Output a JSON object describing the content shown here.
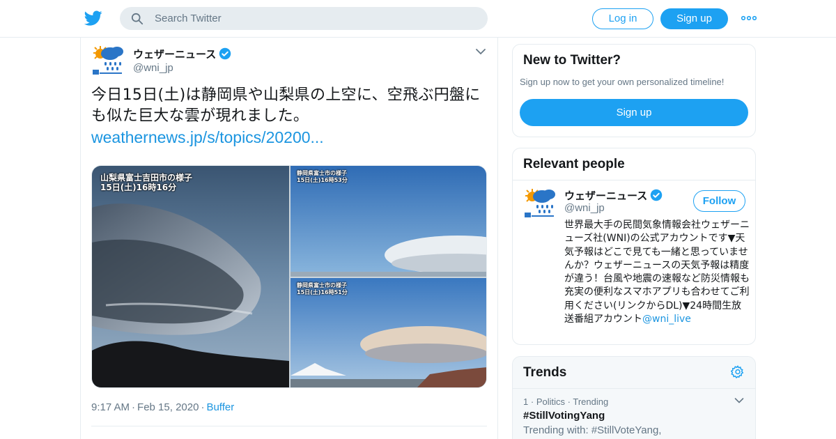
{
  "header": {
    "logo_icon": "twitter-bird-icon",
    "search_placeholder": "Search Twitter",
    "login_label": "Log in",
    "signup_label": "Sign up",
    "more_icon": "more-dots-icon"
  },
  "tweet": {
    "author_name": "ウェザーニュース",
    "author_handle": "@wni_jp",
    "verified": true,
    "text": "今日15日(土)は静岡県や山梨県の上空に、空飛ぶ円盤にも似た巨大な雲が現れました。",
    "link": "weathernews.jp/s/topics/20200...",
    "media": [
      {
        "caption_line1": "山梨県富士吉田市の様子",
        "caption_line2": "15日(土)16時16分"
      },
      {
        "caption_line1": "静岡県富士市の様子",
        "caption_line2": "15日(土)16時53分"
      },
      {
        "caption_line1": "静岡県富士市の様子",
        "caption_line2": "15日(土)16時51分"
      }
    ],
    "time": "9:17 AM",
    "separator": "·",
    "date": "Feb 15, 2020",
    "source": "Buffer"
  },
  "sidebar": {
    "new_to_twitter": {
      "title": "New to Twitter?",
      "subtitle": "Sign up now to get your own personalized timeline!",
      "button": "Sign up"
    },
    "relevant_people": {
      "title": "Relevant people",
      "name": "ウェザーニュース",
      "handle": "@wni_jp",
      "follow_label": "Follow",
      "bio": "世界最大手の民間気象情報会社ウェザーニューズ社(WNI)の公式アカウントです▼天気予報はどこで見ても一緒と思っていませんか？ウェザーニュースの天気予報は精度が違う！台風や地震の速報など防災情報も充実の便利なスマホアプリも合わせてご利用ください(リンクからDL)▼24時間生放送番組アカウント",
      "bio_mention": "@wni_live"
    },
    "trends": {
      "title": "Trends",
      "items": [
        {
          "rank": "1",
          "category": "Politics",
          "status": "Trending",
          "sep": "·",
          "name": "#StillVotingYang",
          "with": "Trending with: #StillVoteYang,"
        }
      ]
    }
  },
  "colors": {
    "accent": "#1da1f2",
    "link": "#1b95e0",
    "text": "#14171a",
    "secondary": "#657786",
    "border": "#e6ecf0"
  }
}
